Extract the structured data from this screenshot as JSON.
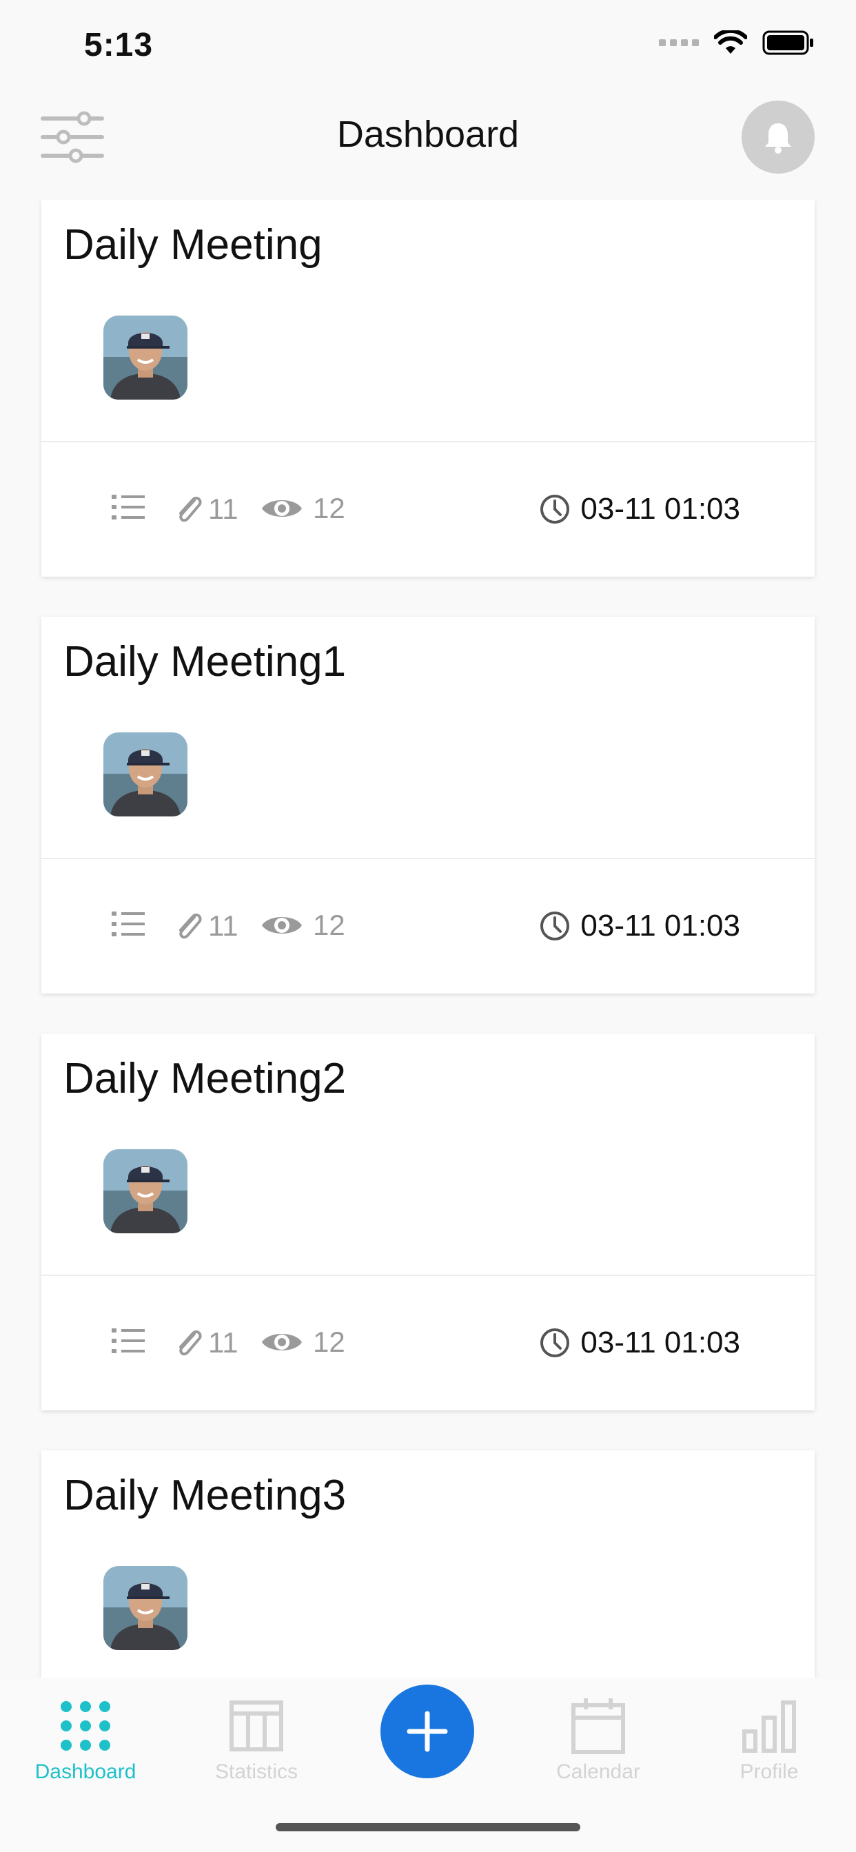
{
  "status_bar": {
    "time": "5:13"
  },
  "header": {
    "title": "Dashboard"
  },
  "cards": [
    {
      "title": "Daily Meeting",
      "attachments": "11",
      "views": "12",
      "time": "03-11 01:03"
    },
    {
      "title": "Daily Meeting1",
      "attachments": "11",
      "views": "12",
      "time": "03-11 01:03"
    },
    {
      "title": "Daily Meeting2",
      "attachments": "11",
      "views": "12",
      "time": "03-11 01:03"
    },
    {
      "title": "Daily Meeting3"
    }
  ],
  "tabbar": {
    "tabs": [
      {
        "label": "Dashboard",
        "icon": "grid-dots-icon",
        "active": true
      },
      {
        "label": "Statistics",
        "icon": "table-icon",
        "active": false
      },
      {
        "label": "",
        "icon": "plus-icon"
      },
      {
        "label": "Calendar",
        "icon": "calendar-icon",
        "active": false
      },
      {
        "label": "Profile",
        "icon": "bar-chart-icon",
        "active": false
      }
    ]
  },
  "colors": {
    "accent_teal": "#1ec1c9",
    "fab_blue": "#1976e0",
    "inactive_gray": "#d3d3d3",
    "meta_gray": "#9a9a9a"
  }
}
